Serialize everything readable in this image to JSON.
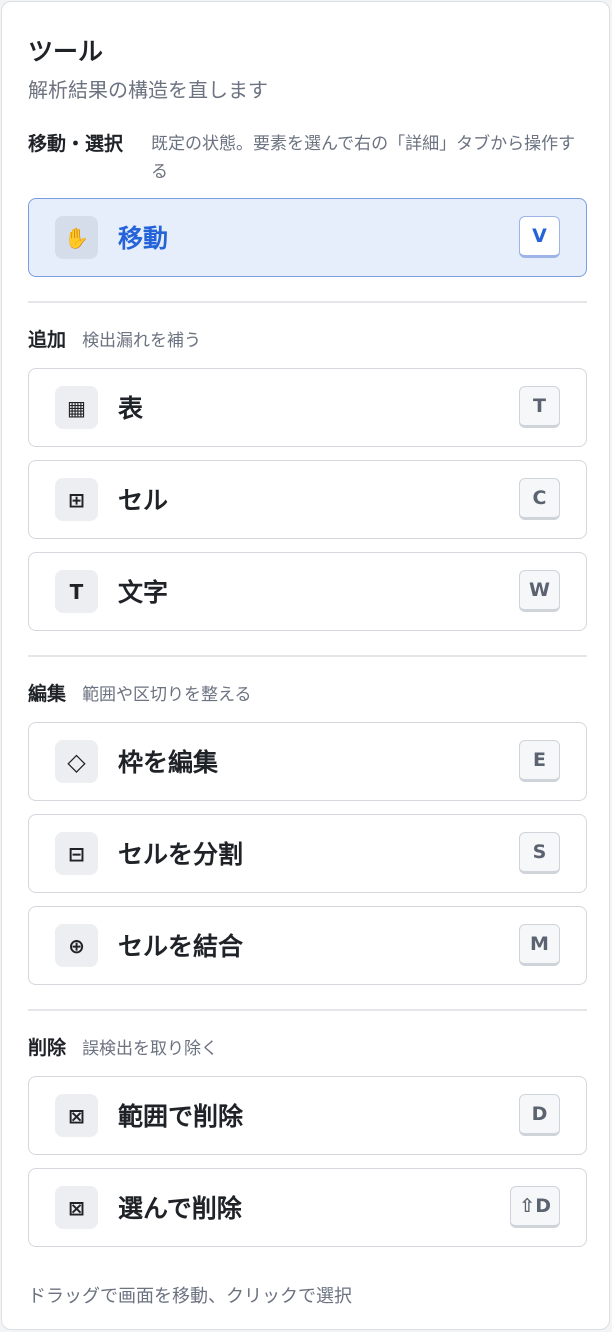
{
  "panel": {
    "title": "ツール",
    "subtitle": "解析結果の構造を直します"
  },
  "sections": {
    "select": {
      "title": "移動・選択",
      "desc": "既定の状態。要素を選んで右の「詳細」タブから操作する",
      "tools": [
        {
          "label": "移動",
          "key": "V",
          "icon": "hand-icon",
          "glyph": "✋",
          "active": true
        }
      ]
    },
    "add": {
      "title": "追加",
      "desc": "検出漏れを補う",
      "tools": [
        {
          "label": "表",
          "key": "T",
          "icon": "table-grid-icon",
          "glyph": "▦"
        },
        {
          "label": "セル",
          "key": "C",
          "icon": "cell-plus-icon",
          "glyph": "⊞"
        },
        {
          "label": "文字",
          "key": "W",
          "icon": "text-t-icon",
          "glyph": "T"
        }
      ]
    },
    "edit": {
      "title": "編集",
      "desc": "範囲や区切りを整える",
      "tools": [
        {
          "label": "枠を編集",
          "key": "E",
          "icon": "diamond-icon",
          "glyph": "◇"
        },
        {
          "label": "セルを分割",
          "key": "S",
          "icon": "split-cell-icon",
          "glyph": "⊟"
        },
        {
          "label": "セルを結合",
          "key": "M",
          "icon": "merge-cell-icon",
          "glyph": "⊕"
        }
      ]
    },
    "delete": {
      "title": "削除",
      "desc": "誤検出を取り除く",
      "tools": [
        {
          "label": "範囲で削除",
          "key": "D",
          "icon": "delete-box-icon",
          "glyph": "⊠"
        },
        {
          "label": "選んで削除",
          "key": "⇧D",
          "icon": "delete-box-icon",
          "glyph": "⊠"
        }
      ]
    }
  },
  "footer": "ドラッグで画面を移動、クリックで選択",
  "colors": {
    "accent": "#2563d9",
    "active_bg": "#e6edfb",
    "active_border": "#7a9ee4",
    "muted_text": "#6b7280"
  }
}
